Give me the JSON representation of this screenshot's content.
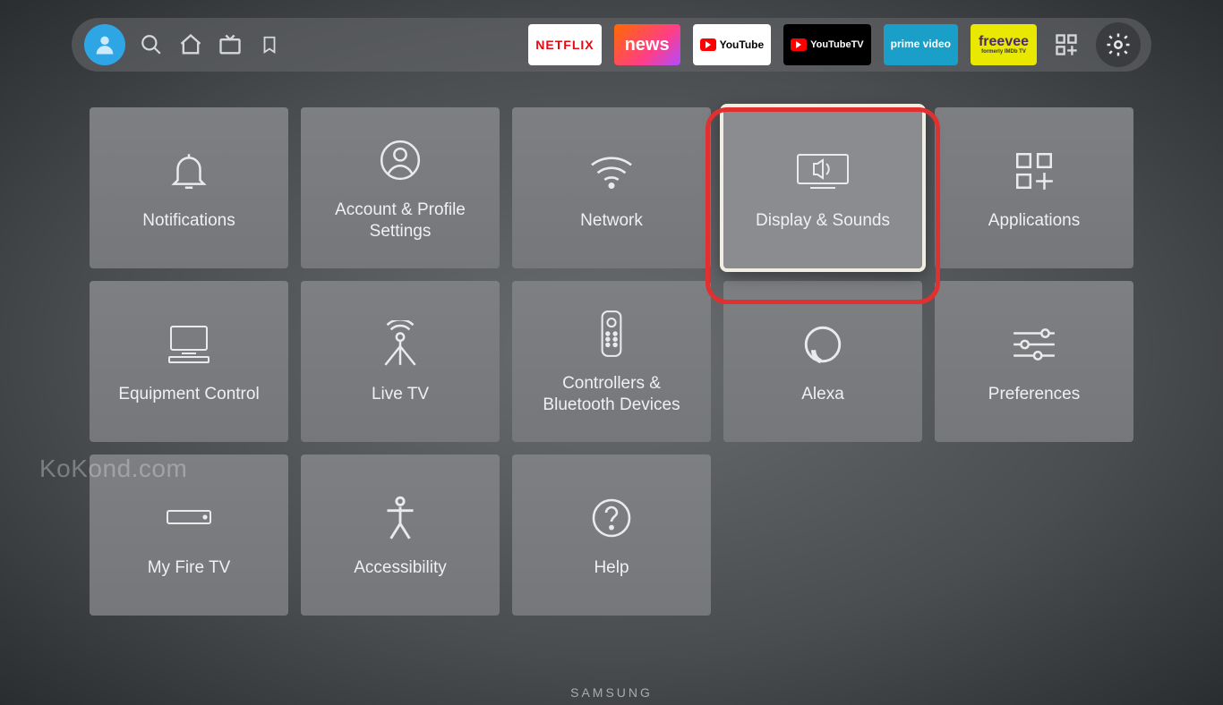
{
  "topbar": {
    "apps": {
      "netflix": "NETFLIX",
      "news": "news",
      "youtube": "YouTube",
      "youtubetv": "YouTubeTV",
      "primevideo": "prime video",
      "freevee": "freevee",
      "freevee_sub": "formerly IMDb TV"
    }
  },
  "tiles": {
    "notifications": "Notifications",
    "account": "Account & Profile Settings",
    "network": "Network",
    "display": "Display & Sounds",
    "applications": "Applications",
    "equipment": "Equipment Control",
    "livetv": "Live TV",
    "controllers": "Controllers & Bluetooth Devices",
    "alexa": "Alexa",
    "preferences": "Preferences",
    "myfiretv": "My Fire TV",
    "accessibility": "Accessibility",
    "help": "Help"
  },
  "watermark": "KoKond.com",
  "tv_brand": "SAMSUNG"
}
